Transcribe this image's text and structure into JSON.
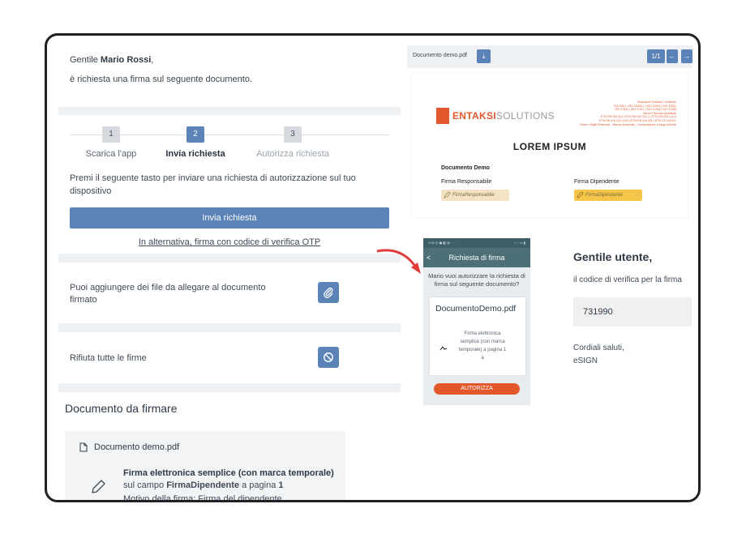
{
  "greeting": {
    "prefix": "Gentile ",
    "name": "Mario Rossi",
    "suffix": ",",
    "line": "è richiesta una firma sul seguente documento."
  },
  "steps": {
    "items": [
      {
        "num": "1",
        "label": "Scarica l'app",
        "state": "done"
      },
      {
        "num": "2",
        "label": "Invia richiesta",
        "state": "active"
      },
      {
        "num": "3",
        "label": "Autorizza richiesta",
        "state": "todo"
      }
    ],
    "description": "Premi il seguente tasto per inviare una richiesta di autorizzazione sul tuo dispositivo",
    "send_button": "Invia richiesta",
    "otp_link": "In alternativa, firma con codice di verifica OTP"
  },
  "attach": {
    "text": "Puoi aggiungere dei file da allegare al documento firmato",
    "icon": "paperclip-icon"
  },
  "reject": {
    "text": "Rifiuta tutte le firme",
    "icon": "prohibited-icon"
  },
  "document": {
    "title": "Documento da firmare",
    "file": "Documento demo.pdf",
    "signature_type": "Firma elettronica semplice (con marca temporale)",
    "field_prefix": "sul campo ",
    "field_name": "FirmaDipendente",
    "field_suffix": " a pagina ",
    "field_page": "1",
    "reason": "Motivo della firma: Firma del dipendente"
  },
  "viewer": {
    "doc_name": "Documento demo.pdf",
    "page_indicator": "1/1",
    "prev": "←",
    "next": "→",
    "download": "⤓"
  },
  "pdf": {
    "logo_main": "ENTAKSI",
    "logo_sub": "SOLUTIONS",
    "cert_lines": [
      "Sistema di Gestione Certificato",
      "ISO 9001 | ISO 20000-1 | ISO 22301 | ISO 37001",
      "ISO 27001 | ISO 27017 | ISO 27018 | ISO 27035",
      "Servizi Fiduciari Qualificati",
      "ETSI EN 319 401 | ETSI EN 319 411-1 | ETSI EN 319 411-2",
      "ETSI EN 319 412-1/2/3 | ETSI EN 319 421 | ETSI TS 119 511",
      "Firme e Sigilli Elettronici - Marche temporali - Conservazione a lungo termine"
    ],
    "heading": "LOREM  IPSUM",
    "doc_label": "Documento Demo",
    "resp_label": "Firma Responsabile",
    "dip_label": "Firma Dipendente",
    "resp_badge": "FirmaResponsabile",
    "dip_badge": "FirmaDipendente"
  },
  "phone": {
    "status": "1:00 ◴ ▣ ◧ ◍ · · ·",
    "status_right": "⌁ ◔ ▭ ▮",
    "header": "Richiesta di firma",
    "back": "<",
    "message": "Mario vuoi autorizzare la richiesta di firma sul seguente documento?",
    "file": "DocumentoDemo.pdf",
    "file_desc": "Firma elettronica semplice (con marca temporale) a pagina 1 a",
    "authorize": "AUTORIZZA"
  },
  "mail": {
    "title": "Gentile utente,",
    "line": "il codice di verifica per la firma",
    "code": "731990",
    "closing": "Cordiali saluti,",
    "sender": "eSIGN"
  },
  "colors": {
    "accent": "#5b83b7",
    "brand": "#e2572c",
    "badge_resp": "#f3e2c4",
    "badge_dip": "#f5c54a"
  }
}
